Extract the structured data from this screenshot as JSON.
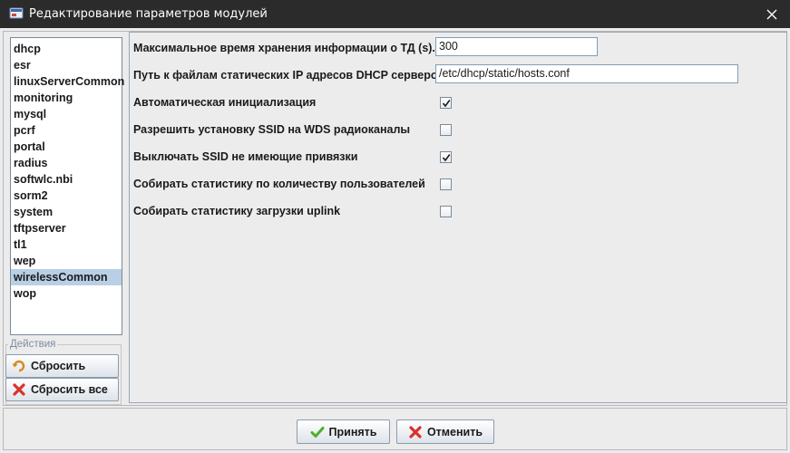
{
  "window": {
    "title": "Редактирование параметров модулей"
  },
  "modules": [
    {
      "label": "dhcp",
      "selected": false
    },
    {
      "label": "esr",
      "selected": false
    },
    {
      "label": "linuxServerCommon",
      "selected": false
    },
    {
      "label": "monitoring",
      "selected": false
    },
    {
      "label": "mysql",
      "selected": false
    },
    {
      "label": "pcrf",
      "selected": false
    },
    {
      "label": "portal",
      "selected": false
    },
    {
      "label": "radius",
      "selected": false
    },
    {
      "label": "softwlc.nbi",
      "selected": false
    },
    {
      "label": "sorm2",
      "selected": false
    },
    {
      "label": "system",
      "selected": false
    },
    {
      "label": "tftpserver",
      "selected": false
    },
    {
      "label": "tl1",
      "selected": false
    },
    {
      "label": "wep",
      "selected": false
    },
    {
      "label": "wirelessCommon",
      "selected": true
    },
    {
      "label": "wop",
      "selected": false
    }
  ],
  "actions": {
    "legend": "Действия",
    "reset_label": "Сбросить",
    "reset_all_label": "Сбросить все"
  },
  "settings": {
    "max_time_label": "Максимальное время хранения информации о ТД (s).",
    "max_time_value": "300",
    "dhcp_path_label": "Путь к файлам статических IP адресов DHCP серверов.",
    "dhcp_path_value": "/etc/dhcp/static/hosts.conf",
    "checkboxes": [
      {
        "label": "Автоматическая инициализация",
        "checked": true
      },
      {
        "label": "Разрешить установку SSID на WDS радиоканалы",
        "checked": false
      },
      {
        "label": "Выключать SSID не имеющие привязки",
        "checked": true
      },
      {
        "label": "Собирать статистику по количеству пользователей",
        "checked": false
      },
      {
        "label": "Собирать статистику загрузки uplink",
        "checked": false
      }
    ]
  },
  "footer": {
    "ok_label": "Принять",
    "cancel_label": "Отменить"
  },
  "colors": {
    "titlebar": "#2b2b2b",
    "selection": "#b8cfe5",
    "accept_green": "#4caf2a",
    "cancel_red": "#d9302c"
  }
}
